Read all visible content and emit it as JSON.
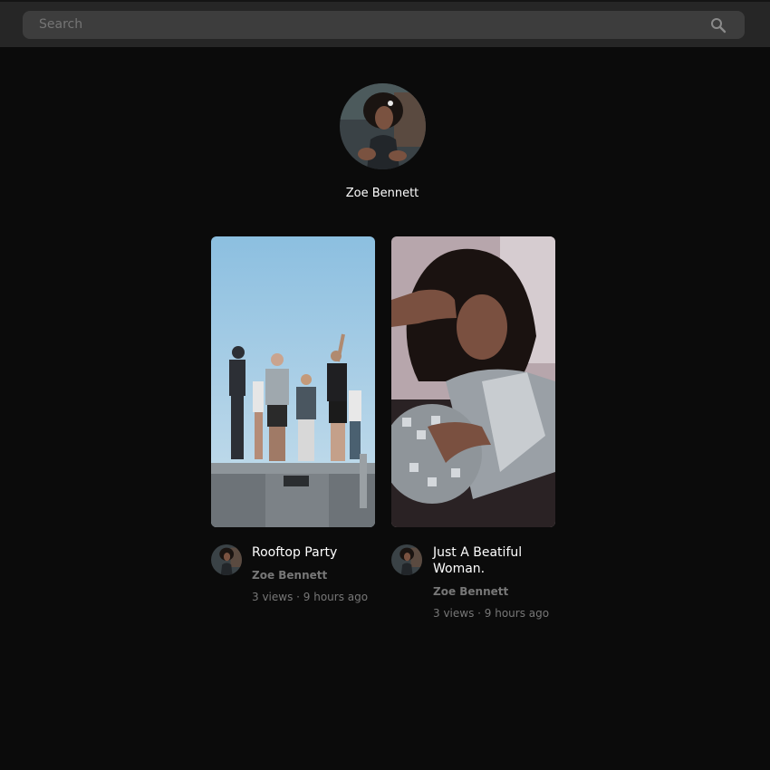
{
  "search": {
    "placeholder": "Search"
  },
  "profile": {
    "name": "Zoe Bennett"
  },
  "videos": [
    {
      "title": "Rooftop Party",
      "channel": "Zoe Bennett",
      "meta": "3 views · 9 hours ago"
    },
    {
      "title": "Just A Beatiful Woman.",
      "channel": "Zoe Bennett",
      "meta": "3 views · 9 hours ago"
    }
  ]
}
